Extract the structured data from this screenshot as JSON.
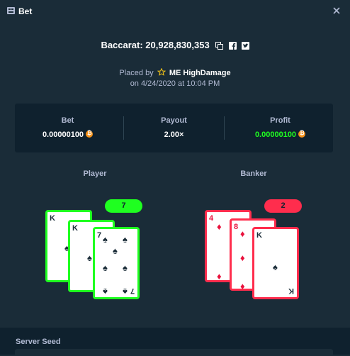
{
  "header": {
    "title": "Bet",
    "icon": "bet-slip-icon",
    "close_icon": "close-icon"
  },
  "bet": {
    "title": "Baccarat: 20,928,830,353",
    "placed_by_prefix": "Placed by",
    "username": "ME HighDamage",
    "timestamp": "on 4/24/2020 at 10:04 PM"
  },
  "stats": {
    "bet_label": "Bet",
    "bet_value": "0.00000100",
    "payout_label": "Payout",
    "payout_value": "2.00×",
    "profit_label": "Profit",
    "profit_value": "0.00000100",
    "currency_icon": "bitcoin-icon",
    "profit_color": "#1fff20"
  },
  "player": {
    "label": "Player",
    "score": "7",
    "color": "#1fff20",
    "cards": [
      {
        "rank": "K",
        "suit": "♠"
      },
      {
        "rank": "K",
        "suit": "♠"
      },
      {
        "rank": "7",
        "suit": "♠"
      }
    ]
  },
  "banker": {
    "label": "Banker",
    "score": "2",
    "color": "#ff2d4d",
    "cards": [
      {
        "rank": "4",
        "suit": "♦"
      },
      {
        "rank": "8",
        "suit": "♦"
      },
      {
        "rank": "K",
        "suit": "♠"
      }
    ]
  },
  "seed": {
    "server_seed_label": "Server Seed"
  }
}
